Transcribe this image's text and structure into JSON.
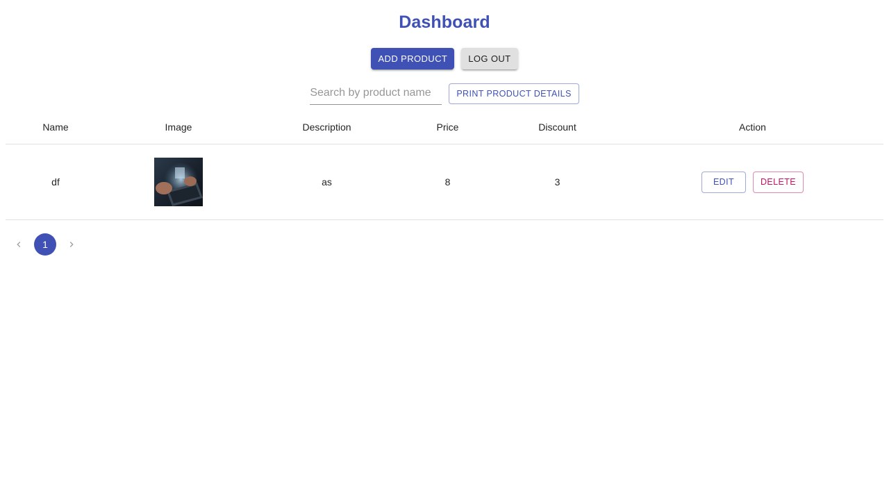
{
  "page": {
    "title": "Dashboard"
  },
  "toolbar": {
    "add_label": "ADD PRODUCT",
    "logout_label": "LOG OUT"
  },
  "search": {
    "placeholder": "Search by product name",
    "value": "",
    "print_label": "PRINT PRODUCT DETAILS"
  },
  "table": {
    "headers": {
      "name": "Name",
      "image": "Image",
      "description": "Description",
      "price": "Price",
      "discount": "Discount",
      "action": "Action"
    },
    "rows": [
      {
        "name": "df",
        "description": "as",
        "price": "8",
        "discount": "3",
        "edit_label": "EDIT",
        "delete_label": "DELETE"
      }
    ]
  },
  "pagination": {
    "current_page": "1",
    "prev_icon": "chevron-left-icon",
    "next_icon": "chevron-right-icon"
  },
  "colors": {
    "primary": "#3f51b5",
    "secondary": "#c51162"
  }
}
